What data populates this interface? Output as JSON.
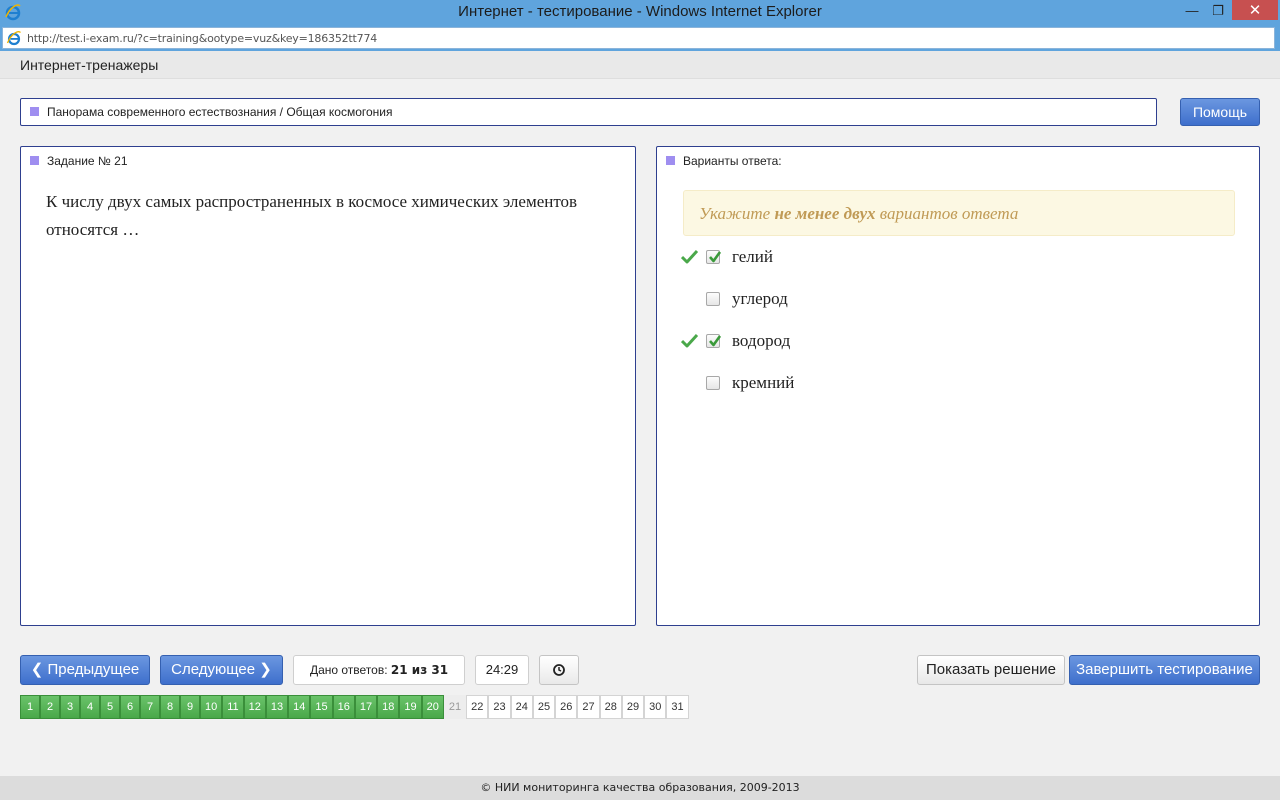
{
  "window": {
    "title": "Интернет - тестирование - Windows Internet Explorer",
    "minimize": "—",
    "maximize": "❐",
    "close": "✕"
  },
  "address": {
    "url": "http://test.i-exam.ru/?c=training&ootype=vuz&key=186352tt774"
  },
  "app": {
    "title": "Интернет-тренажеры"
  },
  "breadcrumb": {
    "text": "Панорама современного естествознания / Общая космогония"
  },
  "help_label": "Помощь",
  "question": {
    "title": "Задание № 21",
    "text": "К числу двух самых распространенных в космосе химических элементов относятся …"
  },
  "answers": {
    "title": "Варианты ответа:",
    "hint_pre": "Укажите ",
    "hint_bold": "не менее двух",
    "hint_post": " вариантов ответа",
    "options": [
      {
        "label": "гелий",
        "checked": true,
        "correct": true
      },
      {
        "label": "углерод",
        "checked": false,
        "correct": false
      },
      {
        "label": "водород",
        "checked": true,
        "correct": true
      },
      {
        "label": "кремний",
        "checked": false,
        "correct": false
      }
    ]
  },
  "toolbar": {
    "prev_label": "Предыдущее",
    "next_label": "Следующее",
    "counter_label": "Дано ответов:",
    "counter_value": "21 из 31",
    "timer": "24:29",
    "show_solution": "Показать решение",
    "finish": "Завершить тестирование"
  },
  "pages": {
    "total": 31,
    "answered_up_to": 20,
    "current": 21,
    "labels": [
      "1",
      "2",
      "3",
      "4",
      "5",
      "6",
      "7",
      "8",
      "9",
      "10",
      "11",
      "12",
      "13",
      "14",
      "15",
      "16",
      "17",
      "18",
      "19",
      "20",
      "21",
      "22",
      "23",
      "24",
      "25",
      "26",
      "27",
      "28",
      "29",
      "30",
      "31"
    ]
  },
  "footer": "© НИИ мониторинга качества образования, 2009-2013",
  "colors": {
    "accent_blue": "#3e6fcc",
    "done_green": "#4aa84a",
    "marker_purple": "#9f8ef0",
    "hint_text": "#c09a55",
    "hint_bg": "#fcf8e3"
  }
}
